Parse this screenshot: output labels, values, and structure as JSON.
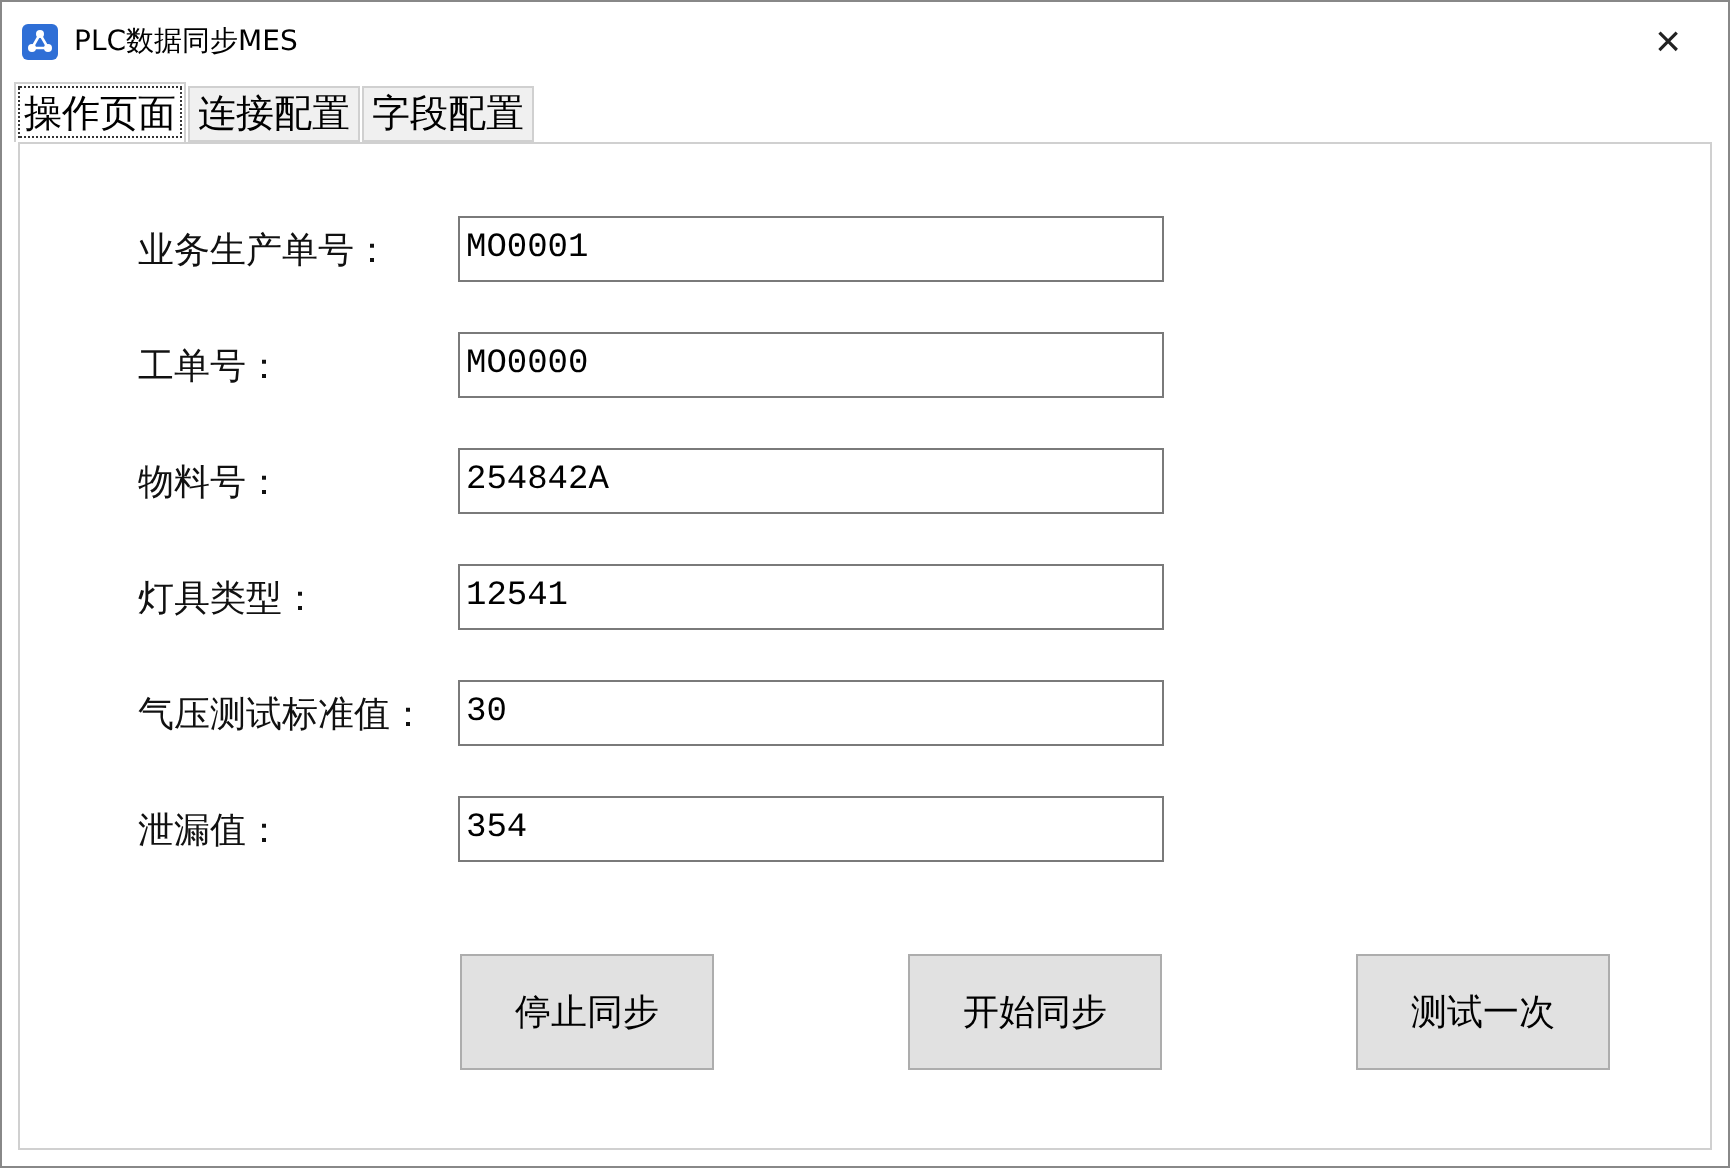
{
  "window": {
    "title": "PLC数据同步MES",
    "close": "×"
  },
  "tabs": [
    {
      "label": "操作页面",
      "selected": true
    },
    {
      "label": "连接配置",
      "selected": false
    },
    {
      "label": "字段配置",
      "selected": false
    }
  ],
  "fields": [
    {
      "label": "业务生产单号：",
      "value": "MO0001"
    },
    {
      "label": "工单号：",
      "value": "MO0000"
    },
    {
      "label": "物料号：",
      "value": "254842A"
    },
    {
      "label": "灯具类型：",
      "value": "12541"
    },
    {
      "label": "气压测试标准值：",
      "value": "30"
    },
    {
      "label": "泄漏值：",
      "value": "354"
    }
  ],
  "buttons": [
    "停止同步",
    "开始同步",
    "测试一次"
  ]
}
